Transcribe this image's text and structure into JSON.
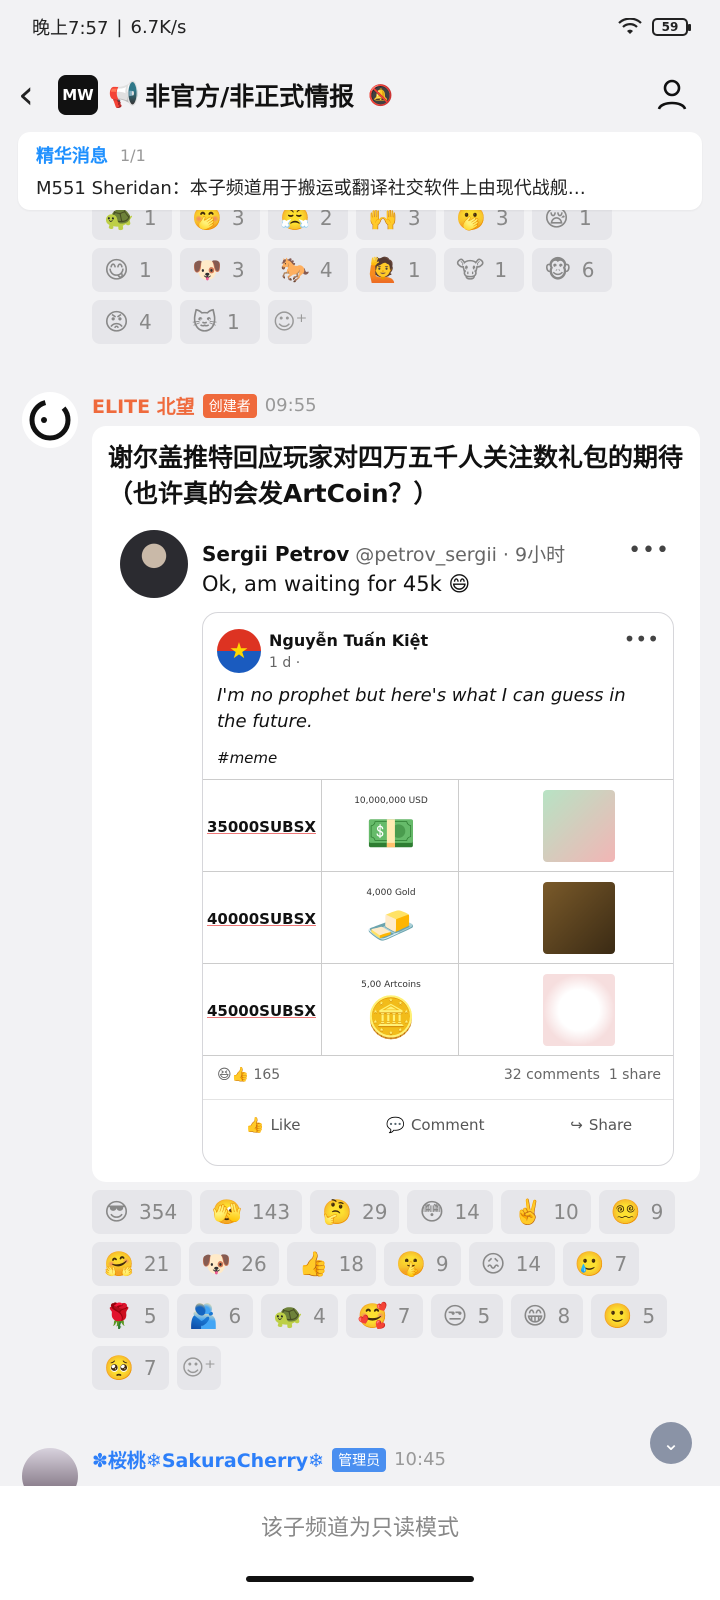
{
  "status": {
    "time": "晚上7:57",
    "speed": "6.7K/s",
    "battery": "59"
  },
  "header": {
    "back": "‹",
    "logo": "MW",
    "megaphone": "📢",
    "title": "非官方/非正式情报",
    "mute_icon": "🔕"
  },
  "pinned": {
    "label": "精华消息",
    "count": "1/1",
    "text": "M551 Sheridan：本子频道用于搬运或翻译社交软件上由现代战舰…"
  },
  "prev_reactions": [
    {
      "emoji": "🐢",
      "count": "1"
    },
    {
      "emoji": "🤭",
      "count": "3"
    },
    {
      "emoji": "😤",
      "count": "2"
    },
    {
      "emoji": "🙌",
      "count": "3"
    },
    {
      "emoji": "🫢",
      "count": "3"
    },
    {
      "emoji": "😪",
      "count": "1"
    },
    {
      "emoji": "😋",
      "count": "1"
    },
    {
      "emoji": "🐶",
      "count": "3"
    },
    {
      "emoji": "🐎",
      "count": "4"
    },
    {
      "emoji": "🙋",
      "count": "1"
    },
    {
      "emoji": "🐮",
      "count": "1"
    },
    {
      "emoji": "🐵",
      "count": "6"
    },
    {
      "emoji": "😡",
      "count": "4"
    },
    {
      "emoji": "🐱",
      "count": "1"
    }
  ],
  "message1": {
    "author": "ELITE 北望",
    "role": "创建者",
    "time": "09:55",
    "text": "谢尔盖推特回应玩家对四万五千人关注数礼包的期待（也许真的会发ArtCoin？）",
    "tweet": {
      "name": "Sergii Petrov",
      "handle": "@petrov_sergii",
      "age": "· 9小时",
      "dots": "•••",
      "text": "Ok, am waiting for 45k 😄"
    },
    "fb": {
      "name": "Nguyễn Tuấn Kiệt",
      "meta": "1 d ·",
      "dots": "•••",
      "post": "I'm no prophet but here's what I can guess in the future.",
      "tag": "#meme",
      "rows": [
        {
          "label": "35000SUBSX",
          "caption": "10,000,000 USD",
          "icon": "💵"
        },
        {
          "label": "40000SUBSX",
          "caption": "4,000 Gold",
          "icon": "🧈"
        },
        {
          "label": "45000SUBSX",
          "caption": "5,00 Artcoins",
          "icon": "🪙"
        }
      ],
      "reactions": "😆👍 165",
      "comments": "32 comments",
      "shares": "1 share",
      "actions": {
        "like": "Like",
        "comment": "Comment",
        "share": "Share"
      }
    }
  },
  "msg1_reactions": [
    {
      "emoji": "😎",
      "count": "354"
    },
    {
      "emoji": "🫣",
      "count": "143"
    },
    {
      "emoji": "🤔",
      "count": "29"
    },
    {
      "emoji": "😳",
      "count": "14"
    },
    {
      "emoji": "✌️",
      "count": "10"
    },
    {
      "emoji": "😵‍💫",
      "count": "9"
    },
    {
      "emoji": "🤗",
      "count": "21"
    },
    {
      "emoji": "🐶",
      "count": "26"
    },
    {
      "emoji": "👍",
      "count": "18"
    },
    {
      "emoji": "🤫",
      "count": "9"
    },
    {
      "emoji": "😖",
      "count": "14"
    },
    {
      "emoji": "🥲",
      "count": "7"
    },
    {
      "emoji": "🌹",
      "count": "5"
    },
    {
      "emoji": "🫂",
      "count": "6"
    },
    {
      "emoji": "🐢",
      "count": "4"
    },
    {
      "emoji": "🥰",
      "count": "7"
    },
    {
      "emoji": "😒",
      "count": "5"
    },
    {
      "emoji": "😁",
      "count": "8"
    },
    {
      "emoji": "🙂",
      "count": "5"
    },
    {
      "emoji": "🥺",
      "count": "7"
    }
  ],
  "message2": {
    "author": "✽桜桃❄SakuraCherry❄",
    "role": "管理员",
    "time": "10:45"
  },
  "footer": {
    "text": "该子频道为只读模式"
  }
}
